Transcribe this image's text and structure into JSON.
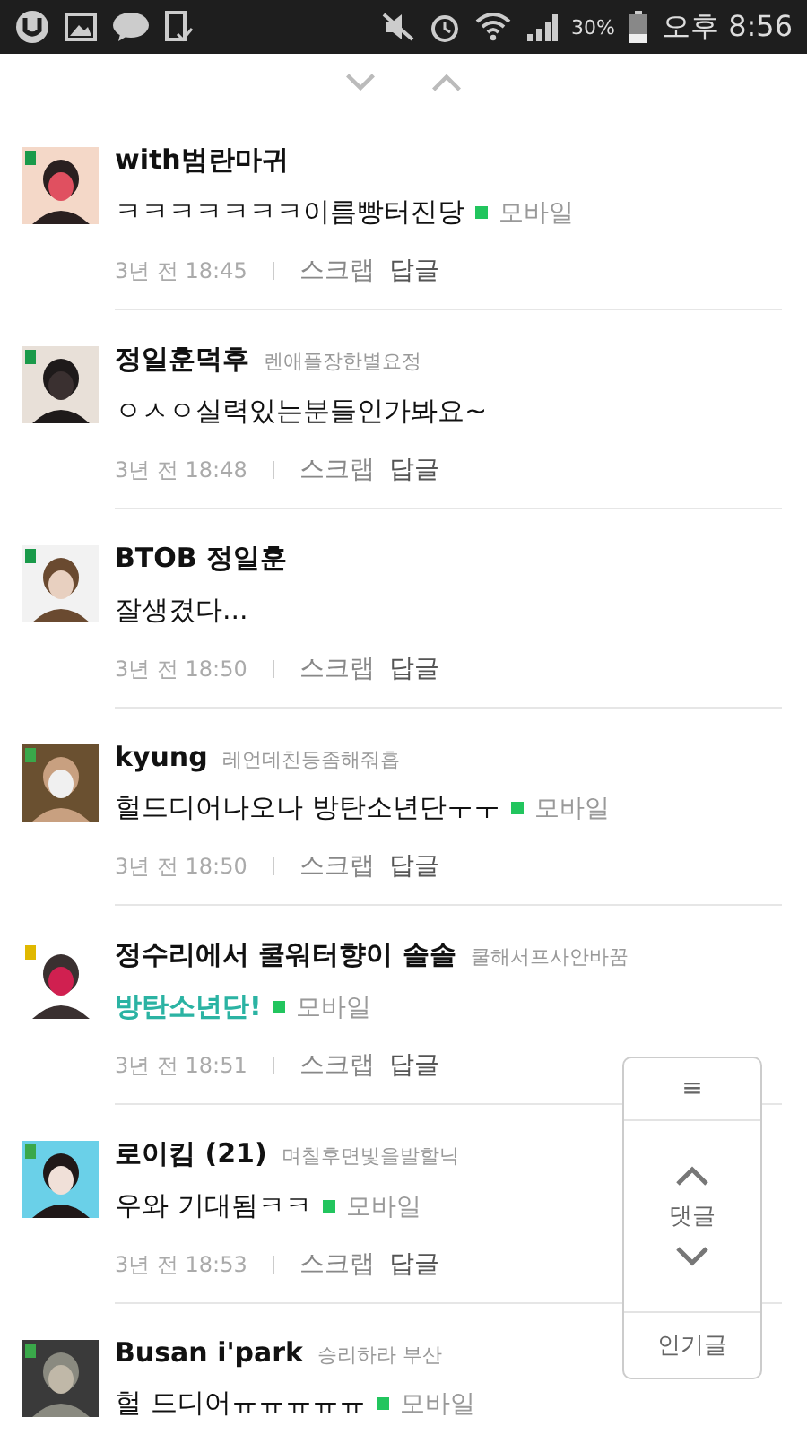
{
  "status_bar": {
    "battery_text": "30%",
    "time": "오후 8:56"
  },
  "comments": [
    {
      "name": "with범란마귀",
      "color": "#1a9a4a",
      "body": "ㅋㅋㅋㅋㅋㅋㅋ이름빵터진당",
      "highlighted": false,
      "mobile": "모바일",
      "time": "3년 전 18:45",
      "scrap": "스크랩",
      "reply": "답글"
    },
    {
      "name": "정일훈덕후",
      "nickname": "렌애플장한별요정",
      "color": "#1a9a4a",
      "body": "ㅇㅅㅇ실력있는분들인가봐요~",
      "highlighted": false,
      "time": "3년 전 18:48",
      "scrap": "스크랩",
      "reply": "답글"
    },
    {
      "name": "BTOB 정일훈",
      "color": "#1a9a4a",
      "body": "잘생겼다...",
      "highlighted": false,
      "time": "3년 전 18:50",
      "scrap": "스크랩",
      "reply": "답글"
    },
    {
      "name": "kyung",
      "nickname": "레언데친등좀해줘흡",
      "color": "#3aa84a",
      "body": "헐드디어나오나 방탄소년단ㅜㅜ",
      "highlighted": false,
      "mobile": "모바일",
      "time": "3년 전 18:50",
      "scrap": "스크랩",
      "reply": "답글"
    },
    {
      "name": "정수리에서 쿨워터향이 솔솔",
      "nickname": "쿨해서프사안바꿈",
      "color": "#e0b800",
      "body": "방탄소년단!",
      "highlighted": true,
      "mobile": "모바일",
      "time": "3년 전 18:51",
      "scrap": "스크랩",
      "reply": "답글"
    },
    {
      "name": "로이킴 (21)",
      "nickname": "며칠후면빛을발할닉",
      "color": "#3aa84a",
      "body": "우와 기대됨ㅋㅋ",
      "highlighted": false,
      "mobile": "모바일",
      "time": "3년 전 18:53",
      "scrap": "스크랩",
      "reply": "답글"
    },
    {
      "name": "Busan i'park",
      "nickname": "승리하라 부산",
      "color": "#3aa84a",
      "body": "헐 드디어ㅠㅠㅠㅠㅠ",
      "highlighted": false,
      "mobile": "모바일"
    }
  ],
  "float_panel": {
    "menu": "≡",
    "label": "댓글",
    "popular": "인기글"
  }
}
